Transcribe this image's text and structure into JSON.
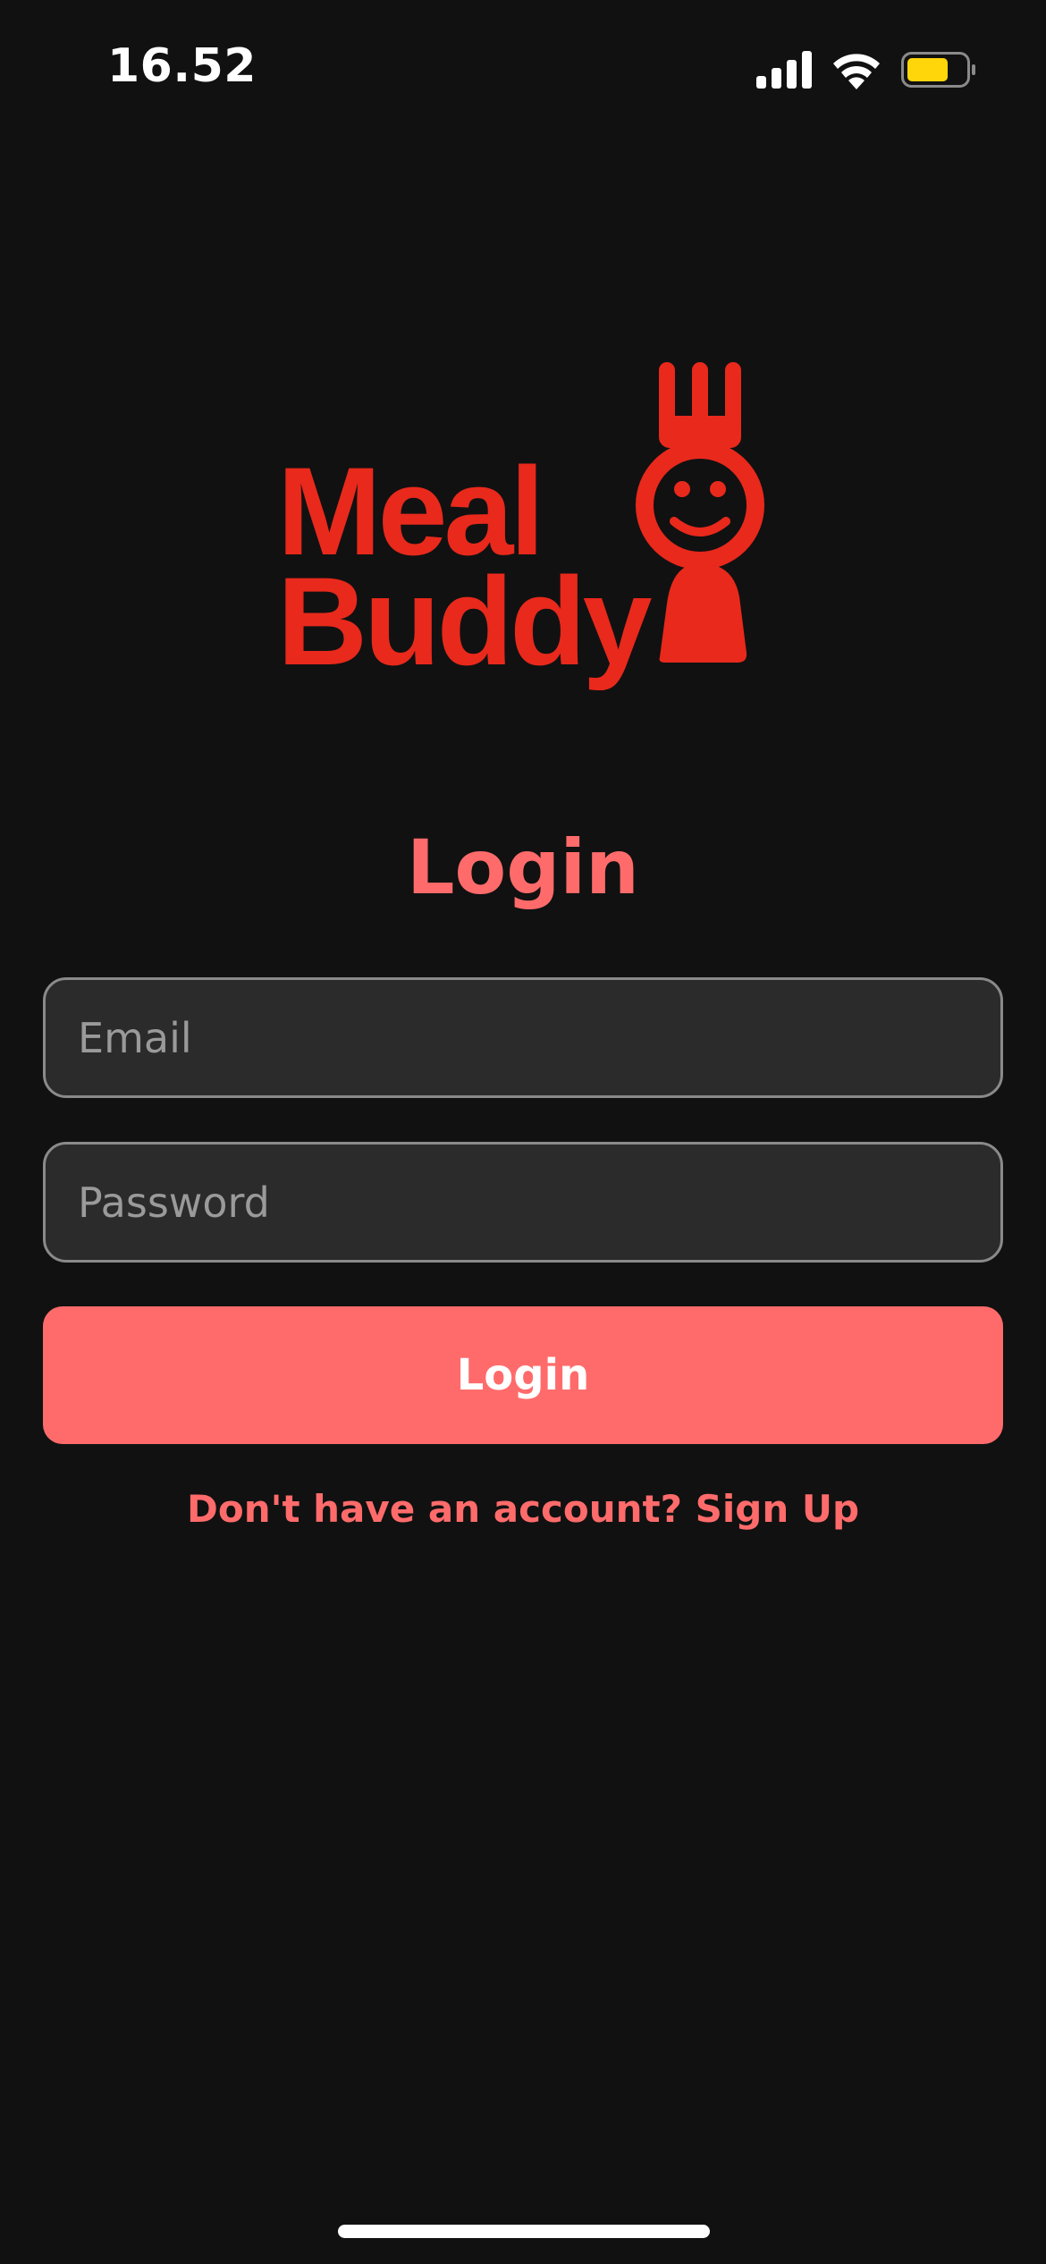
{
  "status_bar": {
    "time": "16.52",
    "signal_icon": "cellular-signal-icon",
    "wifi_icon": "wifi-icon",
    "battery_icon": "battery-icon",
    "battery_color": "#ffd60a"
  },
  "logo": {
    "line1": "Meal",
    "line2": "Buddy",
    "mascot_icon": "fork-smiley-mascot-icon",
    "color": "#e8291c"
  },
  "title": "Login",
  "form": {
    "email_placeholder": "Email",
    "email_value": "",
    "password_placeholder": "Password",
    "password_value": "",
    "submit_label": "Login"
  },
  "signup_prompt": "Don't have an account? Sign Up",
  "colors": {
    "background": "#111111",
    "accent": "#ff6b6b",
    "input_background": "#2b2b2b",
    "input_border": "#8a8a8a"
  }
}
